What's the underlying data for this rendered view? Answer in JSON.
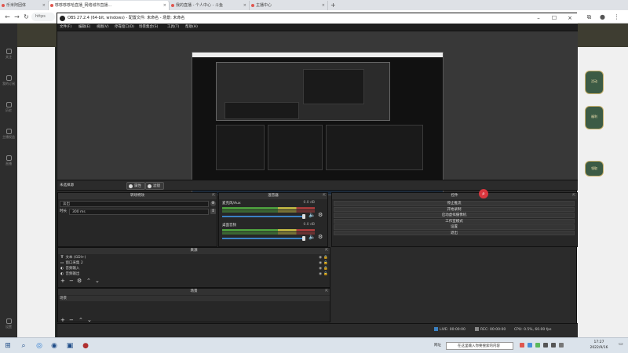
{
  "browser": {
    "tabs": [
      {
        "label": "乐米阿团体",
        "active": false
      },
      {
        "label": "哆哆哆哆哈直播_网络城市直播...",
        "active": true
      },
      {
        "label": "我的直播 - 个人中心 - 斗鱼",
        "active": false
      },
      {
        "label": "主播中心",
        "active": false
      }
    ],
    "new_tab": "+",
    "address": "https"
  },
  "page": {
    "rail_items": [
      "关注",
      "我的订阅",
      "历史",
      "主播权益",
      "直播"
    ],
    "rail_bottom": "设置",
    "badges": [
      "活动",
      "福利",
      "领取"
    ]
  },
  "obs": {
    "title": "OBS 27.2.4 (64-bit, windows) - 配置文件: 未命名 - 场景: 未命名",
    "menu": [
      "文件(F)",
      "编辑(E)",
      "视图(V)",
      "停靠窗口(D)",
      "场景集合(S)",
      "工具(T)",
      "帮助(H)"
    ],
    "scene_bar": {
      "label": "未选择源",
      "btn_properties": "属性",
      "btn_filters": "滤镜"
    },
    "transitions": {
      "title": "转场特效",
      "type_value": "淡出",
      "duration_label": "时长",
      "duration_value": "300 ms"
    },
    "mixer": {
      "title": "混音器",
      "channels": [
        {
          "name": "麦克风/Aux",
          "db": "0.0 dB"
        },
        {
          "name": "桌面音频",
          "db": "0.0 dB"
        }
      ]
    },
    "controls": {
      "title": "控件",
      "buttons": [
        "停止推流",
        "开始录制",
        "启动虚拟摄像机",
        "工作室模式",
        "设置",
        "退出"
      ]
    },
    "sources": {
      "title": "来源",
      "items": [
        {
          "icon": "T",
          "name": "文本 (GDI+)"
        },
        {
          "icon": "▭",
          "name": "窗口采集 2"
        },
        {
          "icon": "◐",
          "name": "音频输入"
        },
        {
          "icon": "◐",
          "name": "音频输出"
        }
      ]
    },
    "scenes": {
      "title": "场景",
      "items": [
        "场景"
      ]
    },
    "status": {
      "live": "LIVE: 00:00:00",
      "rec": "REC: 00:00:00",
      "cpu": "CPU: 0.5%, 60.00 fps"
    }
  },
  "taskbar": {
    "search_label": "网址",
    "search_placeholder": "在这里输入你要搜索的内容",
    "time": "17:27",
    "date": "2022/9/16"
  }
}
